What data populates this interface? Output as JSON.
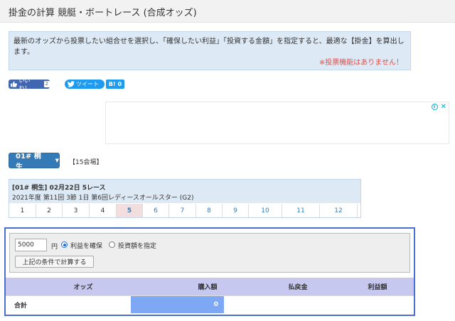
{
  "header": {
    "title": "掛金の計算 競艇・ボートレース (合成オッズ)"
  },
  "info": {
    "text": "最新のオッズから投票したい組合せを選択し、「確保したい利益」「投資する金額」を指定すると、最適な【掛金】を算出します。",
    "warning": "※投票機能はありません！"
  },
  "social": {
    "like_label": "いいね！",
    "like_count": "2",
    "tweet_label": "ツイート",
    "hatena_label": "B!",
    "hatena_count": "0"
  },
  "ad": {
    "info_icon": "i",
    "close_icon": "✕"
  },
  "venue": {
    "selected": "01# 桐生",
    "count": "【15会場】"
  },
  "race": {
    "line1": "[01# 桐生] 02月22日 5レース",
    "line2": "2021年度 第11回 3節 1日 第6回レディースオールスター (G2)",
    "tabs": [
      {
        "label": "1",
        "state": "past"
      },
      {
        "label": "2",
        "state": "past"
      },
      {
        "label": "3",
        "state": "past"
      },
      {
        "label": "4",
        "state": "past"
      },
      {
        "label": "5",
        "state": "active"
      },
      {
        "label": "6",
        "state": "future"
      },
      {
        "label": "7",
        "state": "future"
      },
      {
        "label": "8",
        "state": "future"
      },
      {
        "label": "9",
        "state": "future"
      },
      {
        "label": "10",
        "state": "future"
      },
      {
        "label": "11",
        "state": "future"
      },
      {
        "label": "12",
        "state": "future"
      }
    ]
  },
  "calc": {
    "amount": "5000",
    "unit": "円",
    "option_profit": "利益を確保",
    "option_invest": "投資額を指定",
    "selected_option": "profit",
    "button_label": "上記の条件で計算する"
  },
  "results": {
    "headers": {
      "odds": "オッズ",
      "purchase": "購入額",
      "payout": "払戻金",
      "profit": "利益額"
    },
    "total_label": "合計",
    "total_purchase": "0",
    "total_payout": "",
    "total_profit": ""
  },
  "colors": {
    "accent": "#337ab7",
    "info_bg": "#dde9f5",
    "warning": "#d9534f",
    "table_head": "#c6c8f0",
    "purchase_highlight": "#7fa8f4"
  }
}
